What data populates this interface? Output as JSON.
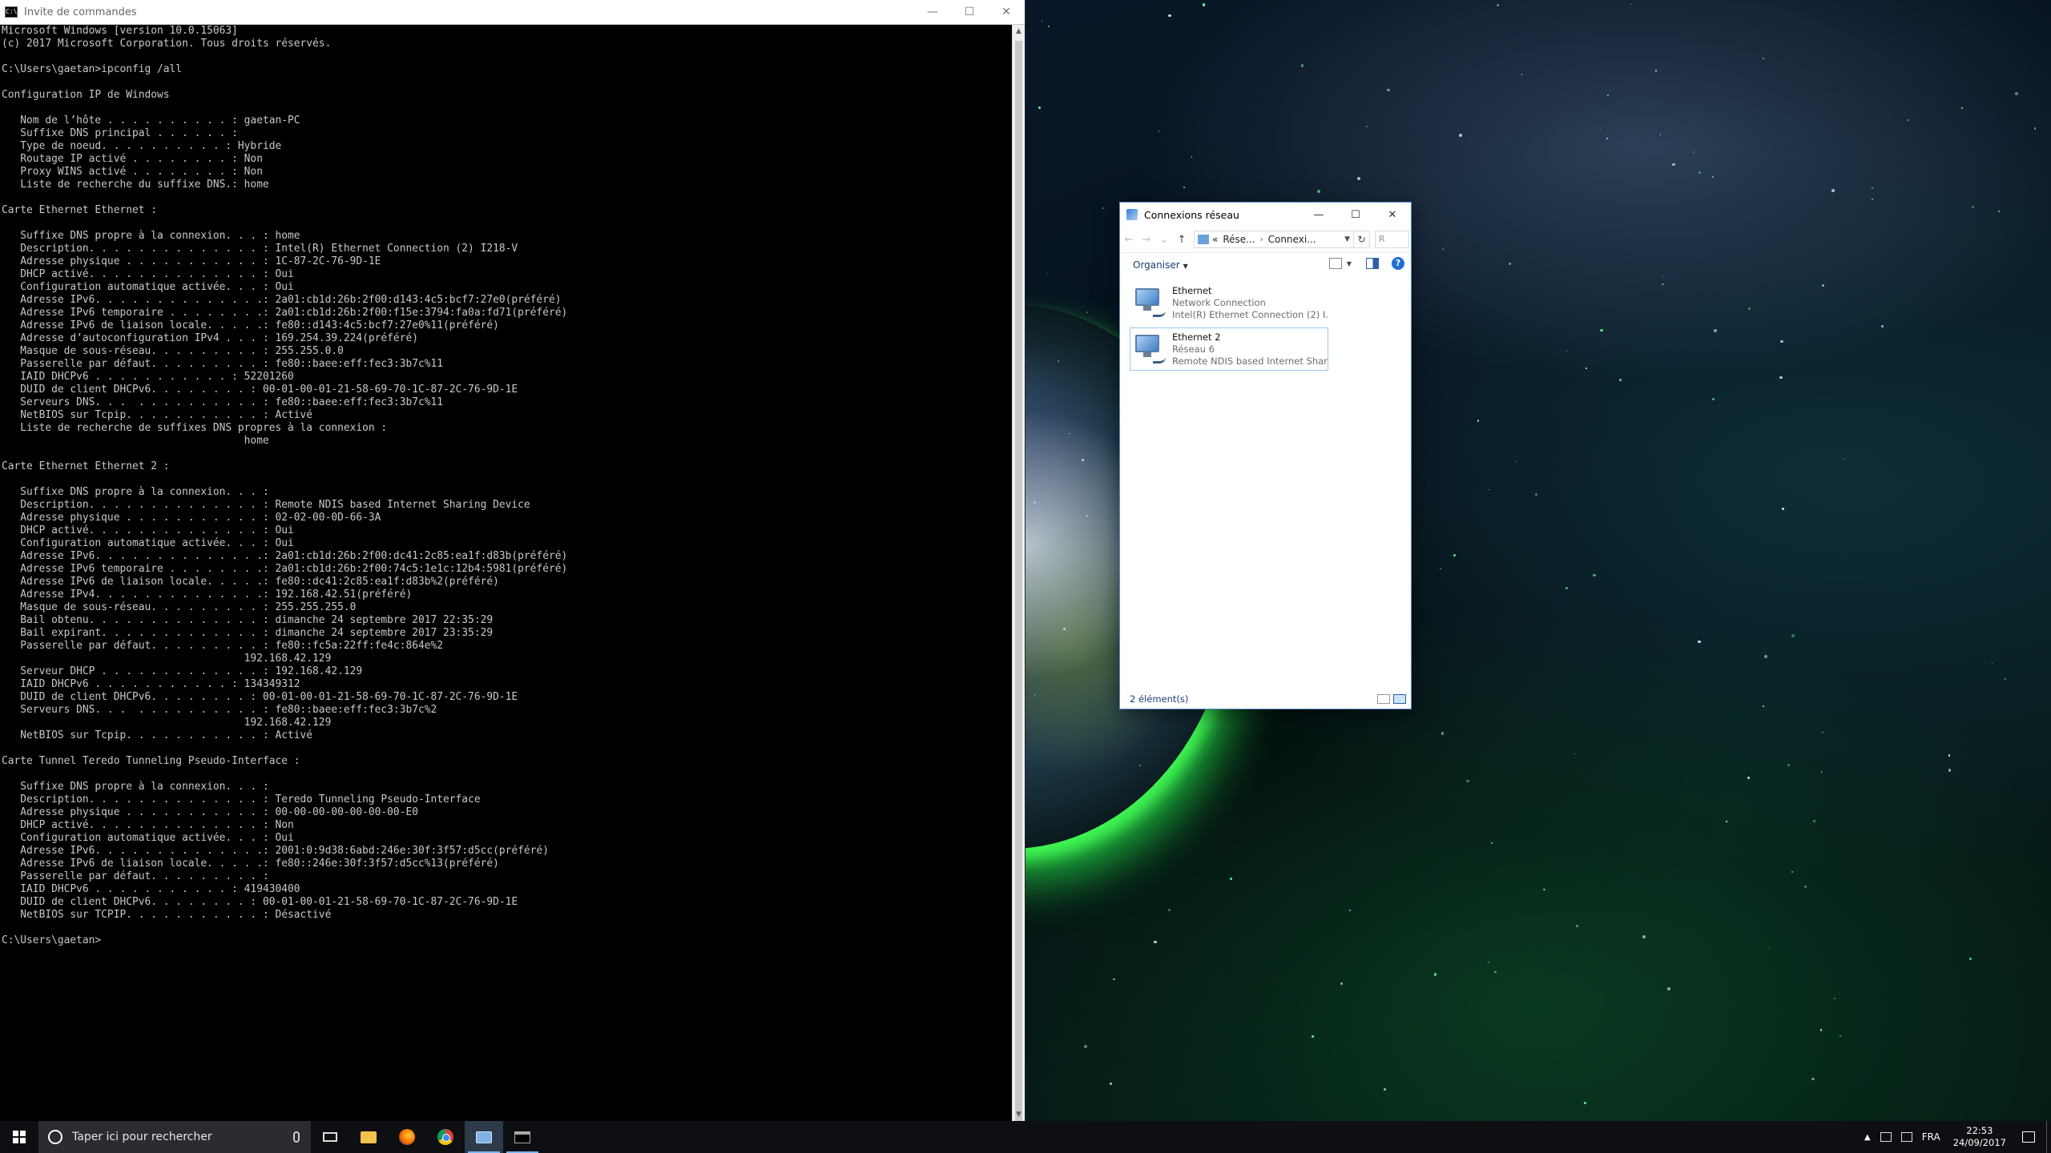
{
  "cmd": {
    "title": "Invite de commandes",
    "icon": "cmd-icon",
    "lines": [
      "Microsoft Windows [version 10.0.15063]",
      "(c) 2017 Microsoft Corporation. Tous droits réservés.",
      "",
      "C:\\Users\\gaetan>ipconfig /all",
      "",
      "Configuration IP de Windows",
      "",
      "   Nom de l’hôte . . . . . . . . . . : gaetan-PC",
      "   Suffixe DNS principal . . . . . . :",
      "   Type de noeud. . . . . . . . . . : Hybride",
      "   Routage IP activé . . . . . . . . : Non",
      "   Proxy WINS activé . . . . . . . . : Non",
      "   Liste de recherche du suffixe DNS.: home",
      "",
      "Carte Ethernet Ethernet :",
      "",
      "   Suffixe DNS propre à la connexion. . . : home",
      "   Description. . . . . . . . . . . . . . : Intel(R) Ethernet Connection (2) I218-V",
      "   Adresse physique . . . . . . . . . . . : 1C-87-2C-76-9D-1E",
      "   DHCP activé. . . . . . . . . . . . . . : Oui",
      "   Configuration automatique activée. . . : Oui",
      "   Adresse IPv6. . . . . . . . . . . . . .: 2a01:cb1d:26b:2f00:d143:4c5:bcf7:27e0(préféré)",
      "   Adresse IPv6 temporaire . . . . . . . .: 2a01:cb1d:26b:2f00:f15e:3794:fa0a:fd71(préféré)",
      "   Adresse IPv6 de liaison locale. . . . .: fe80::d143:4c5:bcf7:27e0%11(préféré)",
      "   Adresse d’autoconfiguration IPv4 . . . : 169.254.39.224(préféré)",
      "   Masque de sous-réseau. . . . . . . . . : 255.255.0.0",
      "   Passerelle par défaut. . . . . . . . . : fe80::baee:eff:fec3:3b7c%11",
      "   IAID DHCPv6 . . . . . . . . . . . : 52201260",
      "   DUID de client DHCPv6. . . . . . . . : 00-01-00-01-21-58-69-70-1C-87-2C-76-9D-1E",
      "   Serveurs DNS. . .  . . . . . . . . . . : fe80::baee:eff:fec3:3b7c%11",
      "   NetBIOS sur Tcpip. . . . . . . . . . . : Activé",
      "   Liste de recherche de suffixes DNS propres à la connexion :",
      "                                       home",
      "",
      "Carte Ethernet Ethernet 2 :",
      "",
      "   Suffixe DNS propre à la connexion. . . :",
      "   Description. . . . . . . . . . . . . . : Remote NDIS based Internet Sharing Device",
      "   Adresse physique . . . . . . . . . . . : 02-02-00-0D-66-3A",
      "   DHCP activé. . . . . . . . . . . . . . : Oui",
      "   Configuration automatique activée. . . : Oui",
      "   Adresse IPv6. . . . . . . . . . . . . .: 2a01:cb1d:26b:2f00:dc41:2c85:ea1f:d83b(préféré)",
      "   Adresse IPv6 temporaire . . . . . . . .: 2a01:cb1d:26b:2f00:74c5:1e1c:12b4:5981(préféré)",
      "   Adresse IPv6 de liaison locale. . . . .: fe80::dc41:2c85:ea1f:d83b%2(préféré)",
      "   Adresse IPv4. . . . . . . . . . . . . .: 192.168.42.51(préféré)",
      "   Masque de sous-réseau. . . . . . . . . : 255.255.255.0",
      "   Bail obtenu. . . . . . . . . . . . . . : dimanche 24 septembre 2017 22:35:29",
      "   Bail expirant. . . . . . . . . . . . . : dimanche 24 septembre 2017 23:35:29",
      "   Passerelle par défaut. . . . . . . . . : fe80::fc5a:22ff:fe4c:864e%2",
      "                                       192.168.42.129",
      "   Serveur DHCP . . . . . . . . . . . . . : 192.168.42.129",
      "   IAID DHCPv6 . . . . . . . . . . . : 134349312",
      "   DUID de client DHCPv6. . . . . . . . : 00-01-00-01-21-58-69-70-1C-87-2C-76-9D-1E",
      "   Serveurs DNS. . .  . . . . . . . . . . : fe80::baee:eff:fec3:3b7c%2",
      "                                       192.168.42.129",
      "   NetBIOS sur Tcpip. . . . . . . . . . . : Activé",
      "",
      "Carte Tunnel Teredo Tunneling Pseudo-Interface :",
      "",
      "   Suffixe DNS propre à la connexion. . . :",
      "   Description. . . . . . . . . . . . . . : Teredo Tunneling Pseudo-Interface",
      "   Adresse physique . . . . . . . . . . . : 00-00-00-00-00-00-00-E0",
      "   DHCP activé. . . . . . . . . . . . . . : Non",
      "   Configuration automatique activée. . . : Oui",
      "   Adresse IPv6. . . . . . . . . . . . . .: 2001:0:9d38:6abd:246e:30f:3f57:d5cc(préféré)",
      "   Adresse IPv6 de liaison locale. . . . .: fe80::246e:30f:3f57:d5cc%13(préféré)",
      "   Passerelle par défaut. . . . . . . . . :",
      "   IAID DHCPv6 . . . . . . . . . . . : 419430400",
      "   DUID de client DHCPv6. . . . . . . . : 00-01-00-01-21-58-69-70-1C-87-2C-76-9D-1E",
      "   NetBIOS sur TCPIP. . . . . . . . . . . : Désactivé",
      "",
      "C:\\Users\\gaetan>"
    ]
  },
  "network_window": {
    "title": "Connexions réseau",
    "address": {
      "prefix": "«",
      "crumb1": "Rése...",
      "separator": "›",
      "crumb2": "Connexi..."
    },
    "search_placeholder": "R",
    "organize_label": "Organiser",
    "items": [
      {
        "name": "Ethernet",
        "network": "Network Connection",
        "device": "Intel(R) Ethernet Connection (2) I..."
      },
      {
        "name": "Ethernet 2",
        "network": "Réseau  6",
        "device": "Remote NDIS based Internet Shari..."
      }
    ],
    "status": "2 élément(s)"
  },
  "taskbar": {
    "search_placeholder": "Taper ici pour rechercher",
    "language": "FRA",
    "time": "22:53",
    "date": "24/09/2017"
  },
  "colors": {
    "cmd_text": "#c8c8c8",
    "taskbar": "#0d0f12",
    "accent": "#1f6fd1"
  }
}
